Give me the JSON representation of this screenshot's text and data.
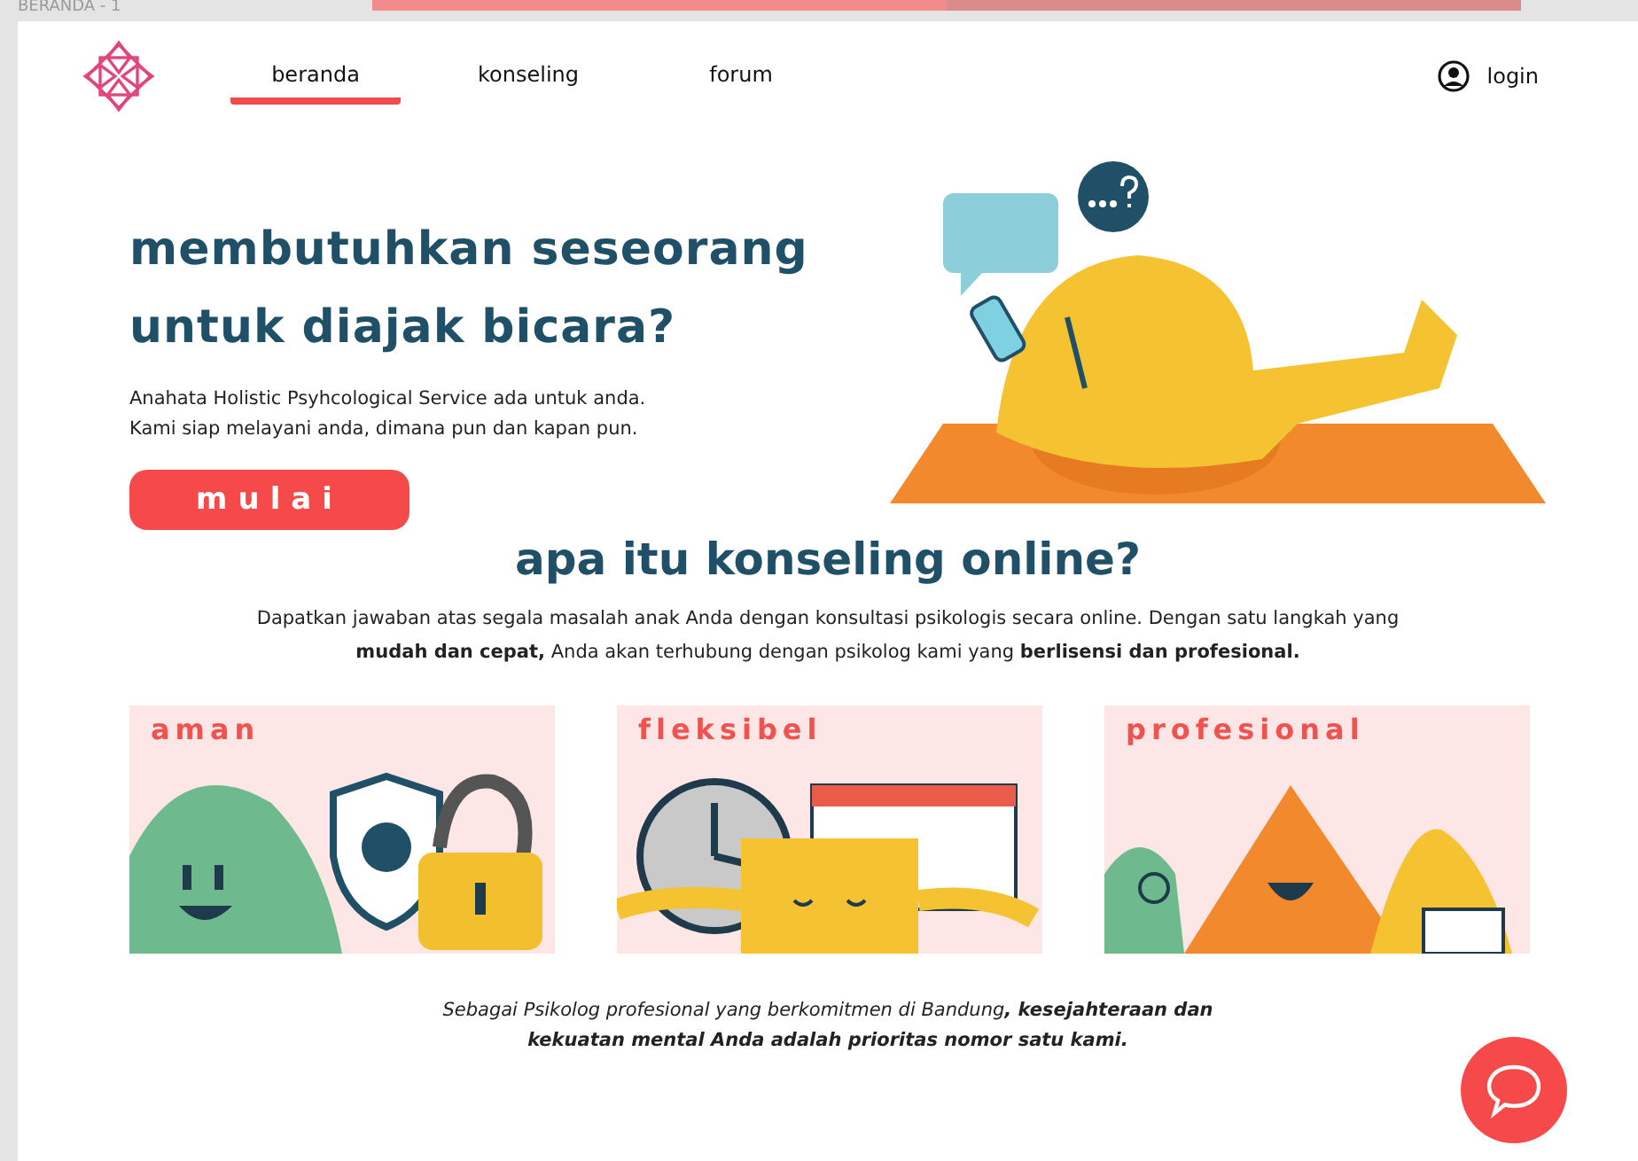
{
  "frame_label": "BERANDA - 1",
  "progress": {
    "level": 0.5
  },
  "nav": {
    "items": [
      {
        "label": "beranda",
        "selected": true
      },
      {
        "label": "konseling",
        "selected": false
      },
      {
        "label": "forum",
        "selected": false
      }
    ],
    "login": "login"
  },
  "hero": {
    "title_lines": [
      "membutuhkan seseorang",
      "untuk diajak bicara?"
    ],
    "text_lines": [
      "Anahata Holistic Psyhcological Service ada untuk anda.",
      "Kami siap melayani anda, dimana pun dan kapan pun."
    ],
    "button": "mulai"
  },
  "about": {
    "title": "apa itu konseling online?",
    "text": "Dapatkan jawaban atas segala masalah anak Anda dengan konsultasi psikologis secara online. Dengan satu langkah yang **mudah dan cepat,** Anda akan terhubung dengan psikolog kami yang **berlisensi dan profesional.**"
  },
  "cards": [
    {
      "title": "aman",
      "kind": "shield"
    },
    {
      "title": "fleksibel",
      "kind": "clock"
    },
    {
      "title": "profesional",
      "kind": "team"
    }
  ],
  "footer_text": "Sebagai Psikolog profesional yang berkomitmen di Bandung**, kesejahteraan dan kekuatan mental Anda adalah prioritas nomor satu kami.**"
}
